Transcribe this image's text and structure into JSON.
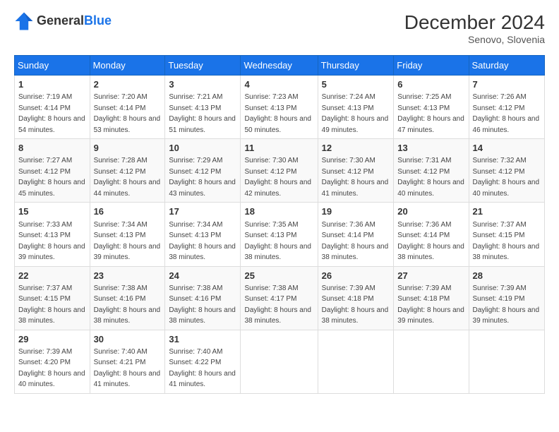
{
  "header": {
    "logo_line1": "General",
    "logo_line2": "Blue",
    "title": "December 2024",
    "subtitle": "Senovo, Slovenia"
  },
  "weekdays": [
    "Sunday",
    "Monday",
    "Tuesday",
    "Wednesday",
    "Thursday",
    "Friday",
    "Saturday"
  ],
  "weeks": [
    [
      {
        "day": "1",
        "sunrise": "Sunrise: 7:19 AM",
        "sunset": "Sunset: 4:14 PM",
        "daylight": "Daylight: 8 hours and 54 minutes."
      },
      {
        "day": "2",
        "sunrise": "Sunrise: 7:20 AM",
        "sunset": "Sunset: 4:14 PM",
        "daylight": "Daylight: 8 hours and 53 minutes."
      },
      {
        "day": "3",
        "sunrise": "Sunrise: 7:21 AM",
        "sunset": "Sunset: 4:13 PM",
        "daylight": "Daylight: 8 hours and 51 minutes."
      },
      {
        "day": "4",
        "sunrise": "Sunrise: 7:23 AM",
        "sunset": "Sunset: 4:13 PM",
        "daylight": "Daylight: 8 hours and 50 minutes."
      },
      {
        "day": "5",
        "sunrise": "Sunrise: 7:24 AM",
        "sunset": "Sunset: 4:13 PM",
        "daylight": "Daylight: 8 hours and 49 minutes."
      },
      {
        "day": "6",
        "sunrise": "Sunrise: 7:25 AM",
        "sunset": "Sunset: 4:13 PM",
        "daylight": "Daylight: 8 hours and 47 minutes."
      },
      {
        "day": "7",
        "sunrise": "Sunrise: 7:26 AM",
        "sunset": "Sunset: 4:12 PM",
        "daylight": "Daylight: 8 hours and 46 minutes."
      }
    ],
    [
      {
        "day": "8",
        "sunrise": "Sunrise: 7:27 AM",
        "sunset": "Sunset: 4:12 PM",
        "daylight": "Daylight: 8 hours and 45 minutes."
      },
      {
        "day": "9",
        "sunrise": "Sunrise: 7:28 AM",
        "sunset": "Sunset: 4:12 PM",
        "daylight": "Daylight: 8 hours and 44 minutes."
      },
      {
        "day": "10",
        "sunrise": "Sunrise: 7:29 AM",
        "sunset": "Sunset: 4:12 PM",
        "daylight": "Daylight: 8 hours and 43 minutes."
      },
      {
        "day": "11",
        "sunrise": "Sunrise: 7:30 AM",
        "sunset": "Sunset: 4:12 PM",
        "daylight": "Daylight: 8 hours and 42 minutes."
      },
      {
        "day": "12",
        "sunrise": "Sunrise: 7:30 AM",
        "sunset": "Sunset: 4:12 PM",
        "daylight": "Daylight: 8 hours and 41 minutes."
      },
      {
        "day": "13",
        "sunrise": "Sunrise: 7:31 AM",
        "sunset": "Sunset: 4:12 PM",
        "daylight": "Daylight: 8 hours and 40 minutes."
      },
      {
        "day": "14",
        "sunrise": "Sunrise: 7:32 AM",
        "sunset": "Sunset: 4:12 PM",
        "daylight": "Daylight: 8 hours and 40 minutes."
      }
    ],
    [
      {
        "day": "15",
        "sunrise": "Sunrise: 7:33 AM",
        "sunset": "Sunset: 4:13 PM",
        "daylight": "Daylight: 8 hours and 39 minutes."
      },
      {
        "day": "16",
        "sunrise": "Sunrise: 7:34 AM",
        "sunset": "Sunset: 4:13 PM",
        "daylight": "Daylight: 8 hours and 39 minutes."
      },
      {
        "day": "17",
        "sunrise": "Sunrise: 7:34 AM",
        "sunset": "Sunset: 4:13 PM",
        "daylight": "Daylight: 8 hours and 38 minutes."
      },
      {
        "day": "18",
        "sunrise": "Sunrise: 7:35 AM",
        "sunset": "Sunset: 4:13 PM",
        "daylight": "Daylight: 8 hours and 38 minutes."
      },
      {
        "day": "19",
        "sunrise": "Sunrise: 7:36 AM",
        "sunset": "Sunset: 4:14 PM",
        "daylight": "Daylight: 8 hours and 38 minutes."
      },
      {
        "day": "20",
        "sunrise": "Sunrise: 7:36 AM",
        "sunset": "Sunset: 4:14 PM",
        "daylight": "Daylight: 8 hours and 38 minutes."
      },
      {
        "day": "21",
        "sunrise": "Sunrise: 7:37 AM",
        "sunset": "Sunset: 4:15 PM",
        "daylight": "Daylight: 8 hours and 38 minutes."
      }
    ],
    [
      {
        "day": "22",
        "sunrise": "Sunrise: 7:37 AM",
        "sunset": "Sunset: 4:15 PM",
        "daylight": "Daylight: 8 hours and 38 minutes."
      },
      {
        "day": "23",
        "sunrise": "Sunrise: 7:38 AM",
        "sunset": "Sunset: 4:16 PM",
        "daylight": "Daylight: 8 hours and 38 minutes."
      },
      {
        "day": "24",
        "sunrise": "Sunrise: 7:38 AM",
        "sunset": "Sunset: 4:16 PM",
        "daylight": "Daylight: 8 hours and 38 minutes."
      },
      {
        "day": "25",
        "sunrise": "Sunrise: 7:38 AM",
        "sunset": "Sunset: 4:17 PM",
        "daylight": "Daylight: 8 hours and 38 minutes."
      },
      {
        "day": "26",
        "sunrise": "Sunrise: 7:39 AM",
        "sunset": "Sunset: 4:18 PM",
        "daylight": "Daylight: 8 hours and 38 minutes."
      },
      {
        "day": "27",
        "sunrise": "Sunrise: 7:39 AM",
        "sunset": "Sunset: 4:18 PM",
        "daylight": "Daylight: 8 hours and 39 minutes."
      },
      {
        "day": "28",
        "sunrise": "Sunrise: 7:39 AM",
        "sunset": "Sunset: 4:19 PM",
        "daylight": "Daylight: 8 hours and 39 minutes."
      }
    ],
    [
      {
        "day": "29",
        "sunrise": "Sunrise: 7:39 AM",
        "sunset": "Sunset: 4:20 PM",
        "daylight": "Daylight: 8 hours and 40 minutes."
      },
      {
        "day": "30",
        "sunrise": "Sunrise: 7:40 AM",
        "sunset": "Sunset: 4:21 PM",
        "daylight": "Daylight: 8 hours and 41 minutes."
      },
      {
        "day": "31",
        "sunrise": "Sunrise: 7:40 AM",
        "sunset": "Sunset: 4:22 PM",
        "daylight": "Daylight: 8 hours and 41 minutes."
      },
      null,
      null,
      null,
      null
    ]
  ]
}
